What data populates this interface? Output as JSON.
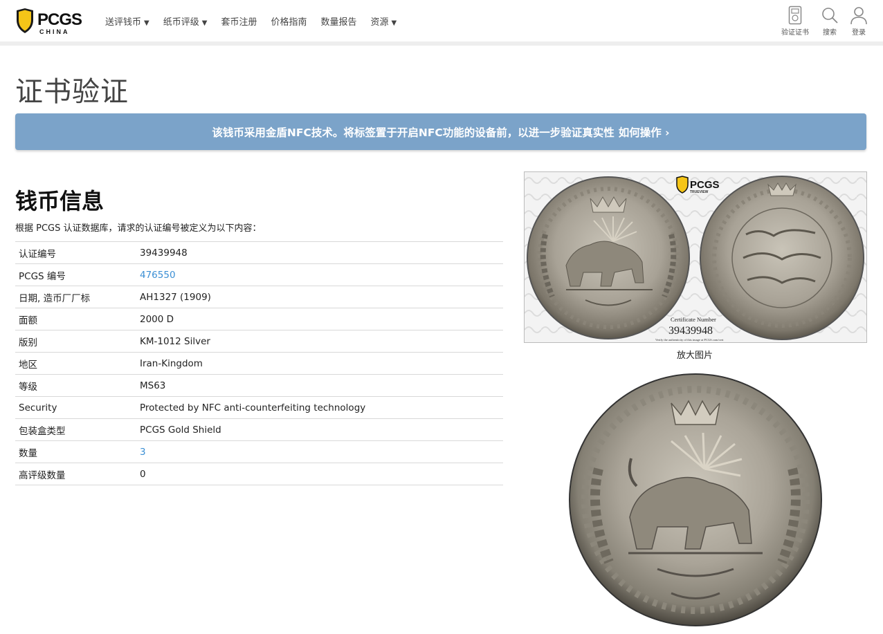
{
  "header": {
    "logo_text": "PCGS",
    "logo_sub": "CHINA",
    "nav": [
      {
        "label": "送评钱币",
        "dropdown": true
      },
      {
        "label": "纸币评级",
        "dropdown": true
      },
      {
        "label": "套币注册",
        "dropdown": false
      },
      {
        "label": "价格指南",
        "dropdown": false
      },
      {
        "label": "数量报告",
        "dropdown": false
      },
      {
        "label": "资源",
        "dropdown": true
      }
    ],
    "tools": {
      "verify": "验证证书",
      "search": "搜索",
      "login": "登录"
    }
  },
  "page_title": "证书验证",
  "nfc_banner": {
    "text": "该钱币采用金盾NFC技术。将标签置于开启NFC功能的设备前，以进一步验证真实性",
    "link": "如何操作 ›"
  },
  "coin_info": {
    "title": "钱币信息",
    "intro": "根据 PCGS 认证数据库，请求的认证编号被定义为以下内容：",
    "rows": [
      {
        "label": "认证编号",
        "value": "39439948",
        "link": false
      },
      {
        "label": "PCGS 编号",
        "value": "476550",
        "link": true
      },
      {
        "label": "日期, 造币厂厂标",
        "value": "AH1327 (1909)",
        "link": false
      },
      {
        "label": "面额",
        "value": "2000 D",
        "link": false
      },
      {
        "label": "版别",
        "value": "KM-1012 Silver",
        "link": false
      },
      {
        "label": "地区",
        "value": "Iran-Kingdom",
        "link": false
      },
      {
        "label": "等级",
        "value": "MS63",
        "link": false
      },
      {
        "label": "Security",
        "value": "Protected by NFC anti-counterfeiting technology",
        "link": false
      },
      {
        "label": "包装盒类型",
        "value": "PCGS Gold Shield",
        "link": false
      },
      {
        "label": "数量",
        "value": "3",
        "link": true
      },
      {
        "label": "高评级数量",
        "value": "0",
        "link": false
      }
    ]
  },
  "trueview": {
    "brand": "PCGS",
    "brand_sub": "TRUEVIEW",
    "cert_label": "Certificate Number",
    "cert_number": "39439948",
    "verify_note": "Verify the authenticity of this image at PCGS.com/cert"
  },
  "zoom_label": "放大图片",
  "colors": {
    "banner": "#7ba3c9",
    "link": "#3b8fd4",
    "shield_gold": "#f5c518"
  }
}
